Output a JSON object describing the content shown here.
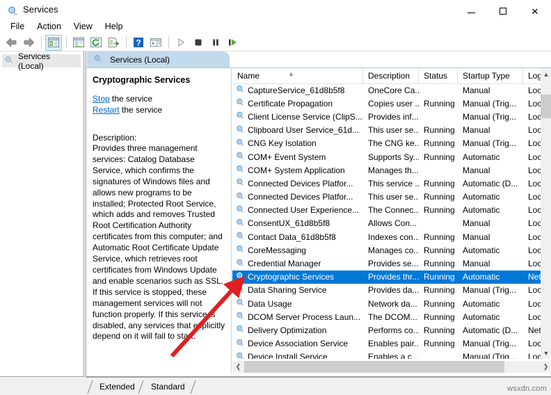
{
  "window": {
    "title": "Services",
    "icon": "services-gear-icon",
    "minimize_label": "Minimize",
    "maximize_label": "Maximize",
    "close_label": "Close"
  },
  "menubar": {
    "items": [
      {
        "label": "File",
        "name": "menu-file"
      },
      {
        "label": "Action",
        "name": "menu-action"
      },
      {
        "label": "View",
        "name": "menu-view"
      },
      {
        "label": "Help",
        "name": "menu-help"
      }
    ]
  },
  "toolbar": {
    "buttons": [
      {
        "name": "back-button",
        "icon": "arrow-left-icon"
      },
      {
        "name": "forward-button",
        "icon": "arrow-right-icon"
      },
      {
        "name": "show-hide-console-tree-button",
        "icon": "console-tree-icon",
        "active": true
      },
      {
        "name": "properties-button",
        "icon": "properties-window-icon"
      },
      {
        "name": "refresh-button",
        "icon": "refresh-circle-icon"
      },
      {
        "name": "export-list-button",
        "icon": "export-list-icon"
      },
      {
        "name": "help-button",
        "icon": "question-mark-icon"
      },
      {
        "name": "show-action-pane-button",
        "icon": "action-pane-icon"
      },
      {
        "name": "start-service-button",
        "icon": "play-triangle-icon"
      },
      {
        "name": "stop-service-button",
        "icon": "stop-square-icon"
      },
      {
        "name": "pause-service-button",
        "icon": "pause-bars-icon"
      },
      {
        "name": "restart-service-button",
        "icon": "restart-play-icon"
      }
    ]
  },
  "tree": {
    "root_label": "Services (Local)",
    "root_icon": "services-gear-icon"
  },
  "console": {
    "header_label": "Services (Local)",
    "header_icon": "services-gear-icon"
  },
  "details": {
    "title": "Cryptographic Services",
    "stop_link": "Stop",
    "stop_suffix": " the service",
    "restart_link": "Restart",
    "restart_suffix": " the service",
    "description_label": "Description:",
    "description": "Provides three management services: Catalog Database Service, which confirms the signatures of Windows files and allows new programs to be installed; Protected Root Service, which adds and removes Trusted Root Certification Authority certificates from this computer; and Automatic Root Certificate Update Service, which retrieves root certificates from Windows Update and enable scenarios such as SSL. If this service is stopped, these management services will not function properly. If this service is disabled, any services that explicitly depend on it will fail to start."
  },
  "list": {
    "columns": [
      {
        "key": "name",
        "label": "Name",
        "sorted": true,
        "sort_direction": "ascending"
      },
      {
        "key": "description",
        "label": "Description"
      },
      {
        "key": "status",
        "label": "Status"
      },
      {
        "key": "startup",
        "label": "Startup Type"
      },
      {
        "key": "logon",
        "label": "Log"
      }
    ],
    "rows": [
      {
        "name": "CaptureService_61d8b5f8",
        "description": "OneCore Ca...",
        "status": "",
        "startup": "Manual",
        "logon": "Loc",
        "selected": false
      },
      {
        "name": "Certificate Propagation",
        "description": "Copies user ...",
        "status": "Running",
        "startup": "Manual (Trig...",
        "logon": "Loc",
        "selected": false
      },
      {
        "name": "Client License Service (ClipS...",
        "description": "Provides inf...",
        "status": "",
        "startup": "Manual (Trig...",
        "logon": "Loc",
        "selected": false
      },
      {
        "name": "Clipboard User Service_61d...",
        "description": "This user se...",
        "status": "Running",
        "startup": "Manual",
        "logon": "Loc",
        "selected": false
      },
      {
        "name": "CNG Key Isolation",
        "description": "The CNG ke...",
        "status": "Running",
        "startup": "Manual (Trig...",
        "logon": "Loc",
        "selected": false
      },
      {
        "name": "COM+ Event System",
        "description": "Supports Sy...",
        "status": "Running",
        "startup": "Automatic",
        "logon": "Loc",
        "selected": false
      },
      {
        "name": "COM+ System Application",
        "description": "Manages th...",
        "status": "",
        "startup": "Manual",
        "logon": "Loc",
        "selected": false
      },
      {
        "name": "Connected Devices Platfor...",
        "description": "This service ...",
        "status": "Running",
        "startup": "Automatic (D...",
        "logon": "Loc",
        "selected": false
      },
      {
        "name": "Connected Devices Platfor...",
        "description": "This user se...",
        "status": "Running",
        "startup": "Automatic",
        "logon": "Loc",
        "selected": false
      },
      {
        "name": "Connected User Experience...",
        "description": "The Connec...",
        "status": "Running",
        "startup": "Automatic",
        "logon": "Loc",
        "selected": false
      },
      {
        "name": "ConsentUX_61d8b5f8",
        "description": "Allows Con...",
        "status": "",
        "startup": "Manual",
        "logon": "Loc",
        "selected": false
      },
      {
        "name": "Contact Data_61d8b5f8",
        "description": "Indexes con...",
        "status": "Running",
        "startup": "Manual",
        "logon": "Loc",
        "selected": false
      },
      {
        "name": "CoreMessaging",
        "description": "Manages co...",
        "status": "Running",
        "startup": "Automatic",
        "logon": "Loc",
        "selected": false
      },
      {
        "name": "Credential Manager",
        "description": "Provides se...",
        "status": "Running",
        "startup": "Manual",
        "logon": "Loc",
        "selected": false
      },
      {
        "name": "Cryptographic Services",
        "description": "Provides thr...",
        "status": "Running",
        "startup": "Automatic",
        "logon": "Net",
        "selected": true
      },
      {
        "name": "Data Sharing Service",
        "description": "Provides da...",
        "status": "Running",
        "startup": "Manual (Trig...",
        "logon": "Loc",
        "selected": false
      },
      {
        "name": "Data Usage",
        "description": "Network da...",
        "status": "Running",
        "startup": "Automatic",
        "logon": "Loc",
        "selected": false
      },
      {
        "name": "DCOM Server Process Laun...",
        "description": "The DCOM...",
        "status": "Running",
        "startup": "Automatic",
        "logon": "Loc",
        "selected": false
      },
      {
        "name": "Delivery Optimization",
        "description": "Performs co...",
        "status": "Running",
        "startup": "Automatic (D...",
        "logon": "Net",
        "selected": false
      },
      {
        "name": "Device Association Service",
        "description": "Enables pair...",
        "status": "Running",
        "startup": "Manual (Trig...",
        "logon": "Loc",
        "selected": false
      },
      {
        "name": "Device Install Service",
        "description": "Enables a c...",
        "status": "",
        "startup": "Manual (Trig...",
        "logon": "Loc",
        "selected": false
      }
    ],
    "row_icon": "service-gear-icon",
    "scroll_up_icon": "chevron-up-icon",
    "scroll_down_icon": "chevron-down-icon",
    "scroll_left_icon": "chevron-left-icon",
    "scroll_right_icon": "chevron-right-icon"
  },
  "tabs": [
    {
      "label": "Extended",
      "name": "tab-extended",
      "active": false
    },
    {
      "label": "Standard",
      "name": "tab-standard",
      "active": true
    }
  ],
  "annotation": {
    "arrow_color": "#e02020",
    "points_to": "Cryptographic Services"
  },
  "watermark": {
    "text": "wsxdn.com"
  },
  "colors": {
    "selection": "#0078d7",
    "console_tab": "#c3d9ec",
    "link": "#0066cc"
  }
}
